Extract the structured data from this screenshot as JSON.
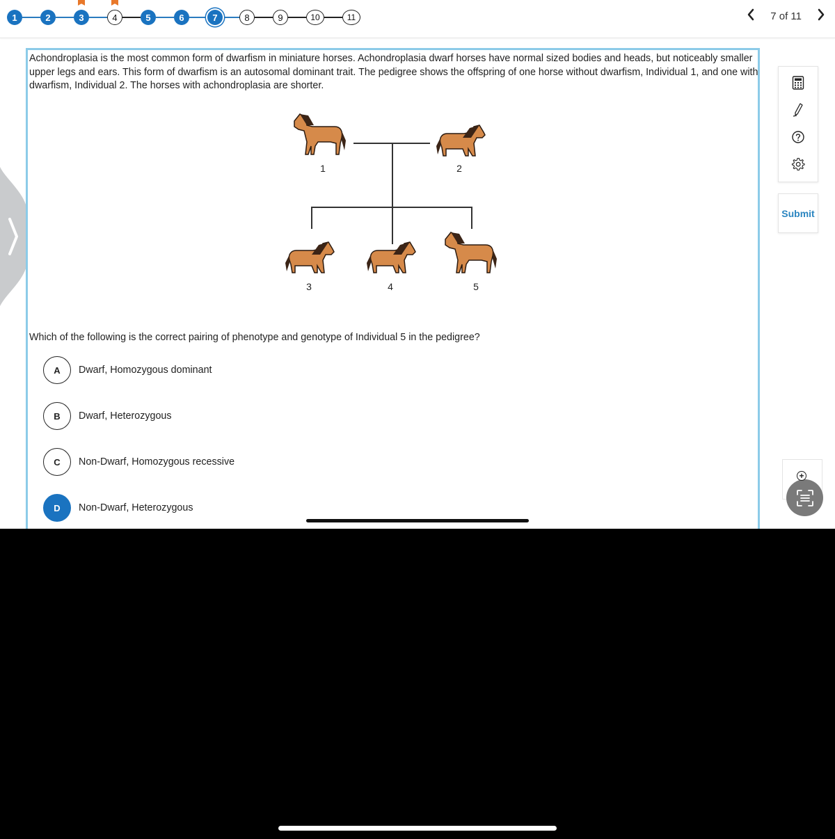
{
  "stepper": {
    "steps": [
      {
        "label": "1",
        "state": "done",
        "flagged": false
      },
      {
        "label": "2",
        "state": "done",
        "flagged": false
      },
      {
        "label": "3",
        "state": "done",
        "flagged": true
      },
      {
        "label": "4",
        "state": "todo",
        "flagged": true
      },
      {
        "label": "5",
        "state": "done",
        "flagged": false
      },
      {
        "label": "6",
        "state": "done",
        "flagged": false
      },
      {
        "label": "7",
        "state": "current",
        "flagged": false
      },
      {
        "label": "8",
        "state": "todo",
        "flagged": false
      },
      {
        "label": "9",
        "state": "todo",
        "flagged": false
      },
      {
        "label": "10",
        "state": "todo",
        "flagged": false
      },
      {
        "label": "11",
        "state": "todo",
        "flagged": false
      }
    ],
    "colors": {
      "done": "#1a73c0",
      "flag": "#e8782a"
    }
  },
  "pager": {
    "prev_icon": "chevron-left-icon",
    "text": "7 of 11",
    "next_icon": "chevron-right-icon",
    "prev_glyph": "‹",
    "next_glyph": "›"
  },
  "passage": {
    "text": "Achondroplasia is the most common form of dwarfism in miniature horses. Achondroplasia dwarf horses have normal sized bodies and heads, but noticeably smaller upper legs and ears. This form of dwarfism is an autosomal dominant trait. The pedigree shows the offspring of one horse without dwarfism, Individual 1, and one with dwarfism, Individual 2. The horses with achondroplasia are shorter."
  },
  "pedigree": {
    "individuals": [
      {
        "label": "1",
        "phenotype": "normal",
        "generation": 1
      },
      {
        "label": "2",
        "phenotype": "dwarf",
        "generation": 1
      },
      {
        "label": "3",
        "phenotype": "dwarf",
        "generation": 2
      },
      {
        "label": "4",
        "phenotype": "dwarf",
        "generation": 2
      },
      {
        "label": "5",
        "phenotype": "normal",
        "generation": 2
      }
    ]
  },
  "question": {
    "text": "Which of the following is the correct pairing of phenotype and genotype of Individual 5 in the pedigree?"
  },
  "choices": [
    {
      "letter": "A",
      "text": "Dwarf, Homozygous dominant",
      "selected": false
    },
    {
      "letter": "B",
      "text": "Dwarf, Heterozygous",
      "selected": false
    },
    {
      "letter": "C",
      "text": "Non-Dwarf, Homozygous recessive",
      "selected": false
    },
    {
      "letter": "D",
      "text": "Non-Dwarf, Heterozygous",
      "selected": true
    }
  ],
  "tools": [
    {
      "name": "calculator-icon"
    },
    {
      "name": "pencil-icon"
    },
    {
      "name": "help-icon"
    },
    {
      "name": "settings-icon"
    }
  ],
  "submit": {
    "label": "Submit",
    "color": "#2a85c0"
  },
  "colors": {
    "accent": "#1a73c0",
    "content_border": "#8ccbe8"
  }
}
